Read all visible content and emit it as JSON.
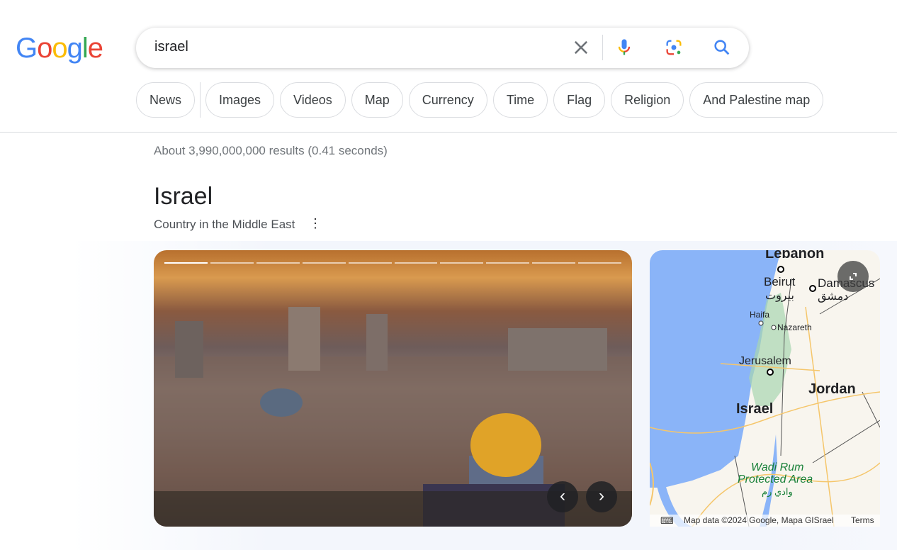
{
  "logo": {
    "text": "Google",
    "letters": [
      [
        "G",
        "#4285f4"
      ],
      [
        "o",
        "#ea4335"
      ],
      [
        "o",
        "#fbbc05"
      ],
      [
        "g",
        "#4285f4"
      ],
      [
        "l",
        "#34a853"
      ],
      [
        "e",
        "#ea4335"
      ]
    ]
  },
  "search": {
    "query": "israel",
    "clear_icon": "close-icon",
    "voice_icon": "mic-icon",
    "lens_icon": "camera-lens-icon",
    "search_icon": "search-icon"
  },
  "chips": [
    "News",
    "Images",
    "Videos",
    "Map",
    "Currency",
    "Time",
    "Flag",
    "Religion",
    "And Palestine map"
  ],
  "stats": "About 3,990,000,000 results (0.41 seconds)",
  "entity": {
    "title": "Israel",
    "subtitle": "Country in the Middle East"
  },
  "carousel": {
    "slides": 10,
    "current": 1
  },
  "map": {
    "labels": {
      "lebanon": "Lebanon",
      "beirut": "Beirut",
      "beirut_ar": "بيروت",
      "damascus": "Damascus",
      "damascus_ar": "دمشق",
      "haifa": "Haifa",
      "nazareth": "Nazareth",
      "jerusalem": "Jerusalem",
      "jordan": "Jordan",
      "israel": "Israel",
      "wadi1": "Wadi Rum",
      "wadi2": "Protected Area",
      "wadi_ar": "وادي رم"
    },
    "attribution": "Map data ©2024 Google, Mapa GISrael",
    "terms": "Terms"
  }
}
